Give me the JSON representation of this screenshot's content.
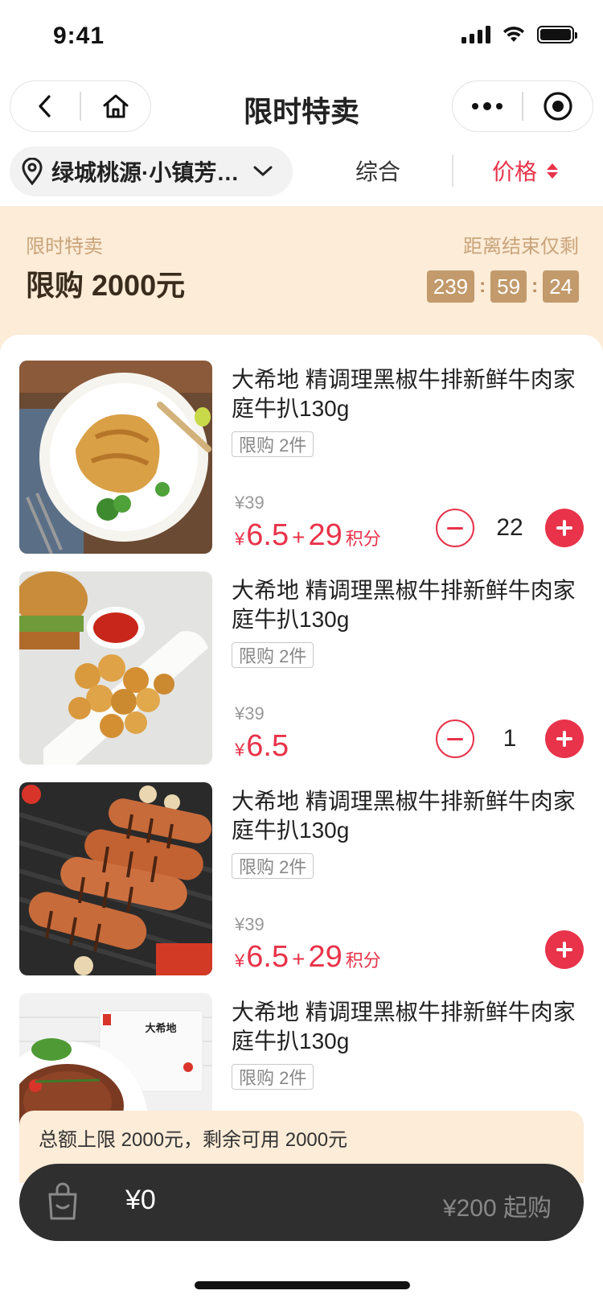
{
  "status_bar": {
    "time": "9:41"
  },
  "nav": {
    "title": "限时特卖"
  },
  "filter": {
    "location": "绿城桃源·小镇芳华苑",
    "sort_general": "综合",
    "sort_price": "价格"
  },
  "promo": {
    "label": "限时特卖",
    "limit": "限购 2000元",
    "countdown_label": "距离结束仅剩",
    "countdown": {
      "hours": "239",
      "minutes": "59",
      "seconds": "24"
    }
  },
  "items": [
    {
      "title": "大希地 精调理黑椒牛排新鲜牛肉家庭牛扒130g",
      "limit": "限购 2件",
      "original_price": "¥39",
      "currency": "¥",
      "price": "6.5",
      "plus": "+",
      "points": "29",
      "points_unit": "积分",
      "quantity": "22",
      "image": "grilled-chicken-plate"
    },
    {
      "title": "大希地 精调理黑椒牛排新鲜牛肉家庭牛扒130g",
      "limit": "限购 2件",
      "original_price": "¥39",
      "currency": "¥",
      "price": "6.5",
      "quantity": "1",
      "image": "fried-chicken-nuggets"
    },
    {
      "title": "大希地 精调理黑椒牛排新鲜牛肉家庭牛扒130g",
      "limit": "限购 2件",
      "original_price": "¥39",
      "currency": "¥",
      "price": "6.5",
      "plus": "+",
      "points": "29",
      "points_unit": "积分",
      "image": "grilled-sausages"
    },
    {
      "title": "大希地 精调理黑椒牛排新鲜牛肉家庭牛扒130g",
      "limit": "限购 2件",
      "brand_label": "大希地",
      "image": "steak-package"
    }
  ],
  "bottom": {
    "total_notice": "总额上限 2000元，剩余可用 2000元",
    "cart_amount": "¥0",
    "min_purchase": "¥200 起购"
  },
  "colors": {
    "accent": "#e8334a",
    "promo_bg": "#fcecd8",
    "countdown_bg": "#c29a6b",
    "cart_bar": "#2f2f2f"
  }
}
